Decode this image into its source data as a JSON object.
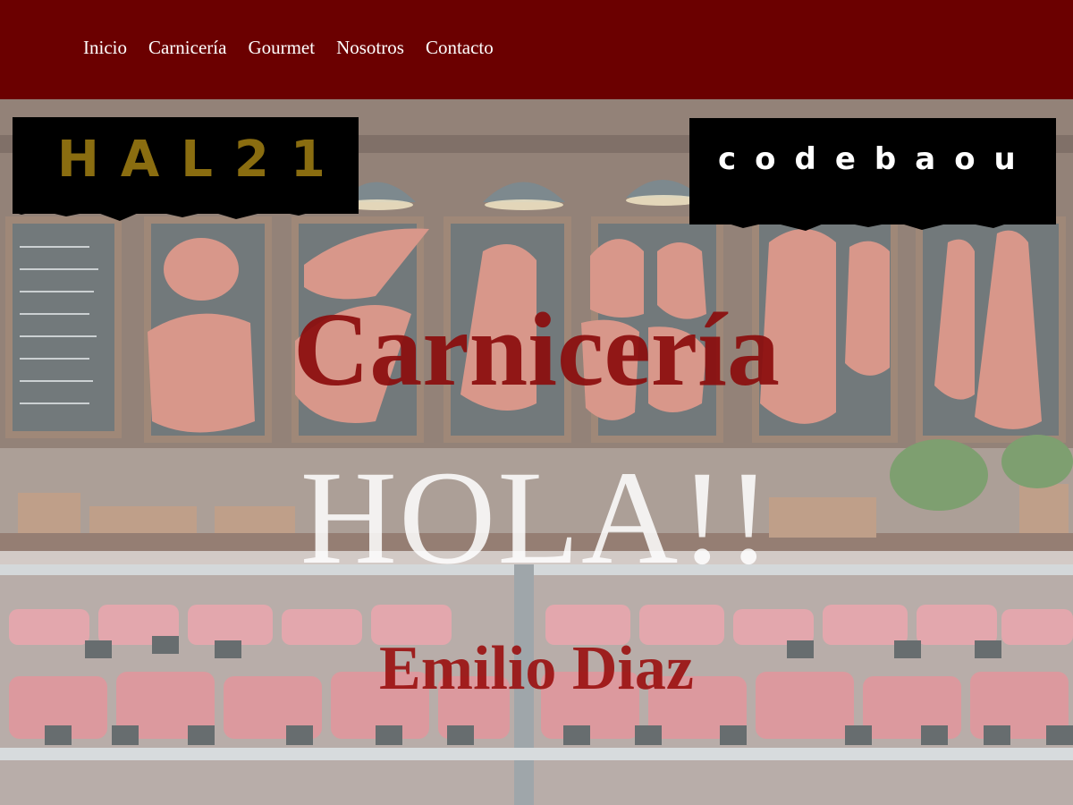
{
  "nav": {
    "items": [
      {
        "label": "Inicio"
      },
      {
        "label": "Carnicería"
      },
      {
        "label": "Gourmet"
      },
      {
        "label": "Nosotros"
      },
      {
        "label": "Contacto"
      }
    ]
  },
  "brand": {
    "left_text": "HAL21",
    "right_text": "codebaou"
  },
  "hero": {
    "title": "Carnicería",
    "greeting": "HOLA!!",
    "subtitle": "Emilio Diaz",
    "image_icon": "butcher-shop-background-image"
  },
  "colors": {
    "navbar": "#6b0000",
    "title": "#8b0d0d",
    "brand_gold": "#8a6d10"
  }
}
